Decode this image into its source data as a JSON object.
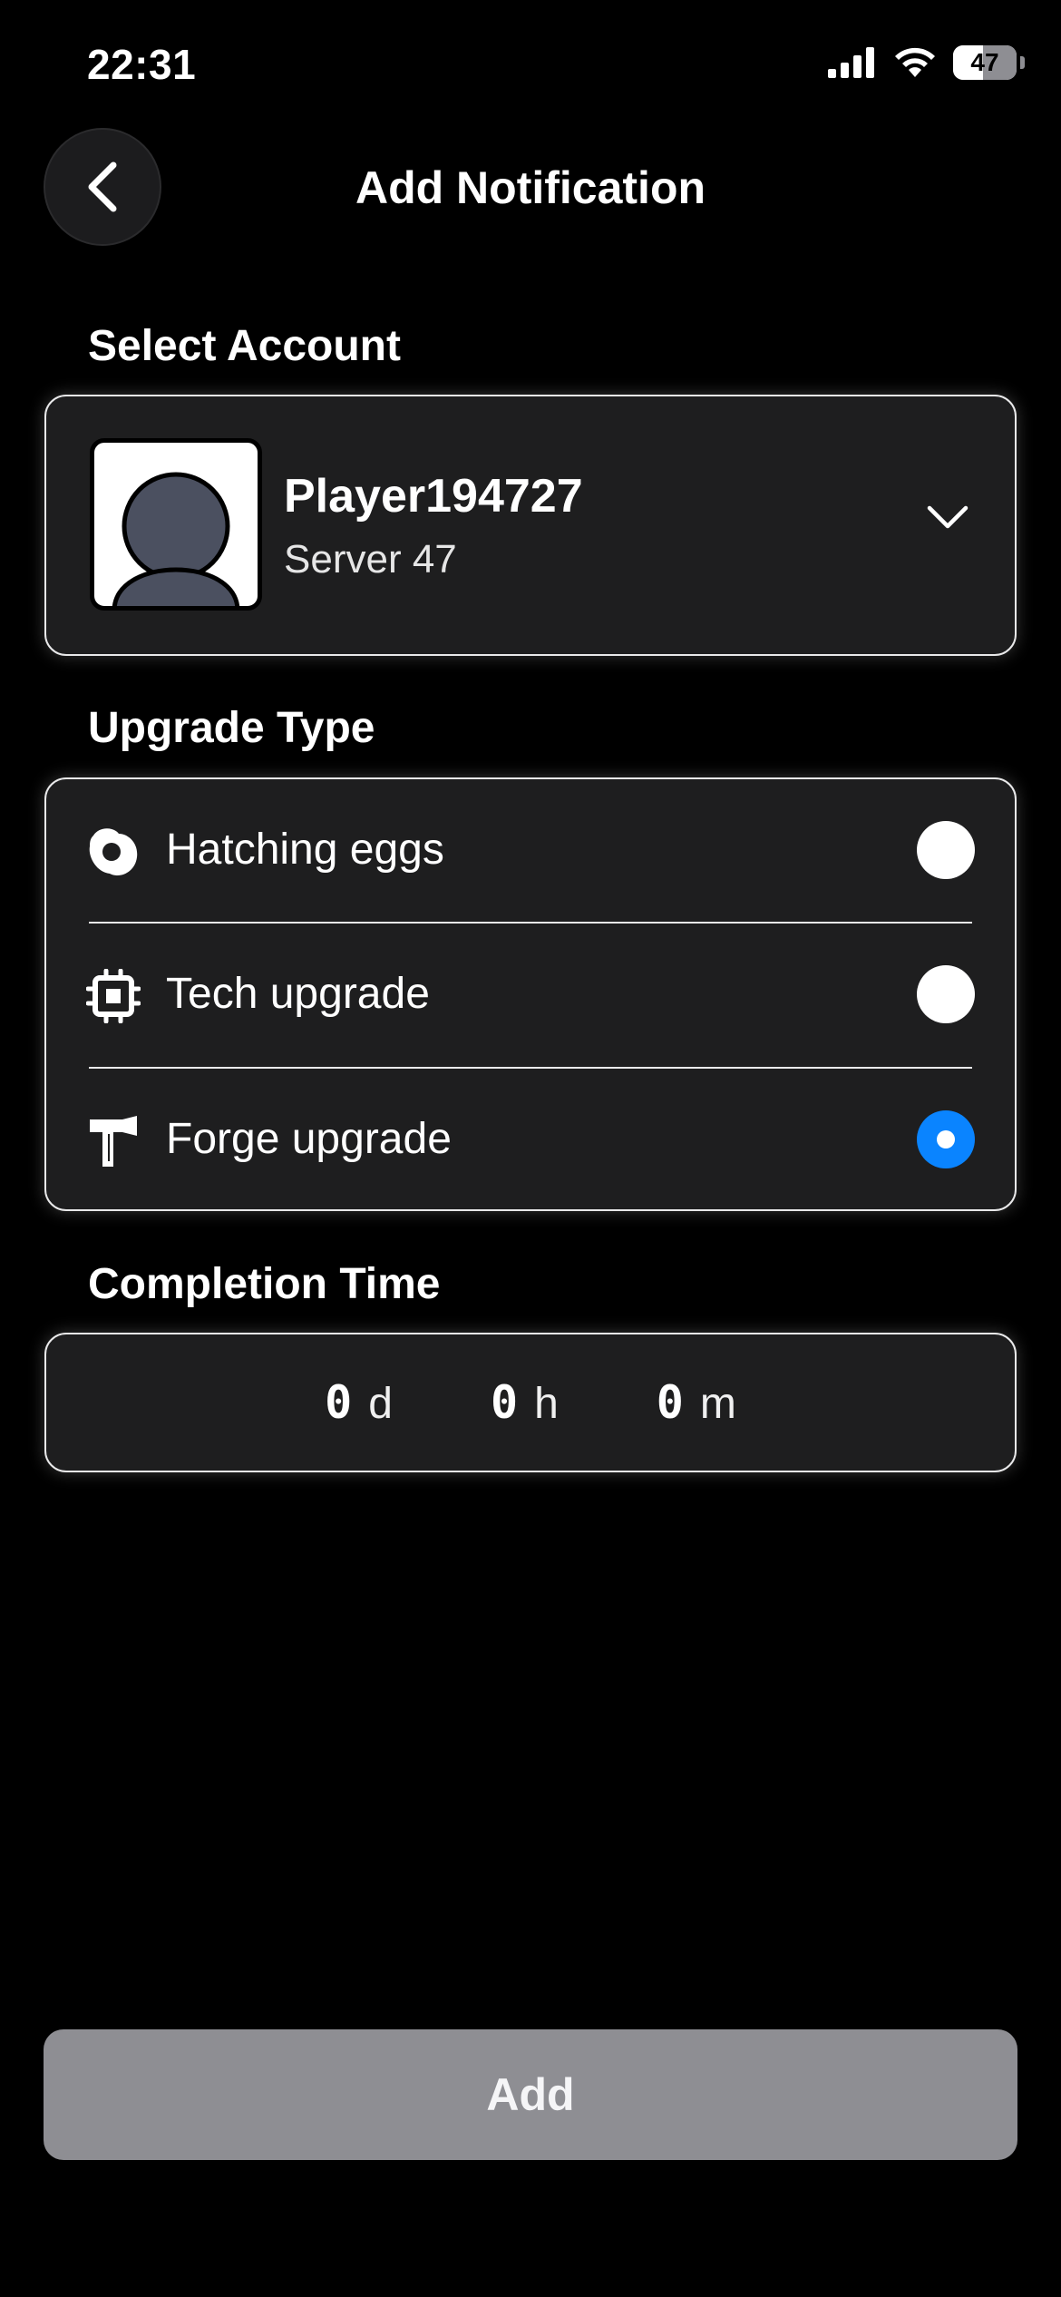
{
  "status_bar": {
    "time": "22:31",
    "battery": "47"
  },
  "header": {
    "title": "Add Notification",
    "back_icon": "chevron-left-icon"
  },
  "account": {
    "section_label": "Select Account",
    "name": "Player194727",
    "server": "Server 47",
    "dropdown_icon": "chevron-down-icon"
  },
  "upgrade": {
    "section_label": "Upgrade Type",
    "options": [
      {
        "label": "Hatching eggs",
        "icon": "egg-icon",
        "selected": false
      },
      {
        "label": "Tech upgrade",
        "icon": "chip-icon",
        "selected": false
      },
      {
        "label": "Forge upgrade",
        "icon": "hammer-icon",
        "selected": true
      }
    ]
  },
  "completion": {
    "section_label": "Completion Time",
    "days": "0",
    "days_unit": "d",
    "hours": "0",
    "hours_unit": "h",
    "minutes": "0",
    "minutes_unit": "m"
  },
  "add_button": {
    "label": "Add"
  },
  "colors": {
    "accent": "#0a84ff",
    "card_bg": "#1e1e1f",
    "button_disabled": "#8e8e93"
  }
}
